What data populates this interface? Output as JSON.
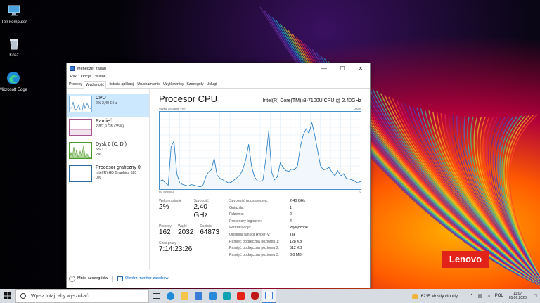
{
  "desktop": {
    "icons": [
      {
        "label": "Ten komputer"
      },
      {
        "label": "Kosz"
      },
      {
        "label": "Microsoft Edge"
      }
    ],
    "brand": "Lenovo"
  },
  "window": {
    "title": "Menedżer zadań",
    "menu": [
      "Plik",
      "Opcje",
      "Widok"
    ],
    "tabs": [
      "Procesy",
      "Wydajność",
      "Historia aplikacji",
      "Uruchamianie",
      "Użytkownicy",
      "Szczegóły",
      "Usługi"
    ],
    "active_tab": "Wydajność",
    "sidebar": [
      {
        "title": "CPU",
        "line1": "2% 2,40 GHz",
        "line2": ""
      },
      {
        "title": "Pamięć",
        "line1": "2,8/7,9 GB (35%)",
        "line2": ""
      },
      {
        "title": "Dysk 0 (C: D:)",
        "line1": "SSD",
        "line2": "2%"
      },
      {
        "title": "Procesor graficzny 0",
        "line1": "Intel(R) HD Graphics 620",
        "line2": "0%"
      }
    ],
    "main": {
      "title": "Procesor CPU",
      "cpu_name": "Intel(R) Core(TM) i3-7100U CPU @ 2.40GHz",
      "graph_label_left": "Wykorzystanie (%)",
      "graph_label_right": "100%",
      "graph_foot_left": "60 sekund",
      "graph_foot_right": "0"
    },
    "stats": {
      "utilization_label": "Wykorzystanie",
      "utilization": "2%",
      "speed_label": "Szybkość",
      "speed": "2,40 GHz",
      "processes_label": "Procesy",
      "processes": "162",
      "threads_label": "Wątki",
      "threads": "2032",
      "handles_label": "Dojścia",
      "handles": "64873",
      "uptime_label": "Czas pracy",
      "uptime": "7:14:23:26"
    },
    "details": [
      {
        "k": "Szybkość podstawowa:",
        "v": "2,40 GHz"
      },
      {
        "k": "Gniazda:",
        "v": "1"
      },
      {
        "k": "Rdzenie:",
        "v": "2"
      },
      {
        "k": "Procesory logiczne:",
        "v": "4"
      },
      {
        "k": "Wirtualizacja:",
        "v": "Wyłączone"
      },
      {
        "k": "Obsługa funkcji Hyper-V:",
        "v": "Tak"
      },
      {
        "k": "Pamięć podręczna poziomu 1:",
        "v": "128 KB"
      },
      {
        "k": "Pamięć podręczna poziomu 2:",
        "v": "512 KB"
      },
      {
        "k": "Pamięć podręczna poziomu 3:",
        "v": "3,0 MB"
      }
    ],
    "footer": {
      "fewer_details": "Mniej szczegółów",
      "open_monitor": "Otwórz monitor zasobów"
    }
  },
  "cpu_history": [
    10,
    12,
    8,
    5,
    55,
    62,
    20,
    8,
    6,
    5,
    4,
    6,
    5,
    4,
    3,
    4,
    15,
    22,
    25,
    40,
    18,
    14,
    12,
    10,
    8,
    9,
    12,
    15,
    18,
    26,
    38,
    58,
    30,
    16,
    11,
    10,
    12,
    40,
    76,
    22,
    12,
    16,
    34,
    28,
    24,
    23,
    26,
    25,
    30,
    55,
    70,
    78,
    72,
    86,
    70,
    50,
    30,
    25,
    26,
    28,
    22,
    17,
    24,
    17,
    20,
    14,
    13,
    12,
    10,
    8,
    10
  ],
  "taskbar": {
    "search_placeholder": "Wpisz tutaj, aby wyszukać",
    "weather": "62°F  Mostly cloudy",
    "language": "POL",
    "time": "11:07",
    "date": "05.06.2023"
  }
}
